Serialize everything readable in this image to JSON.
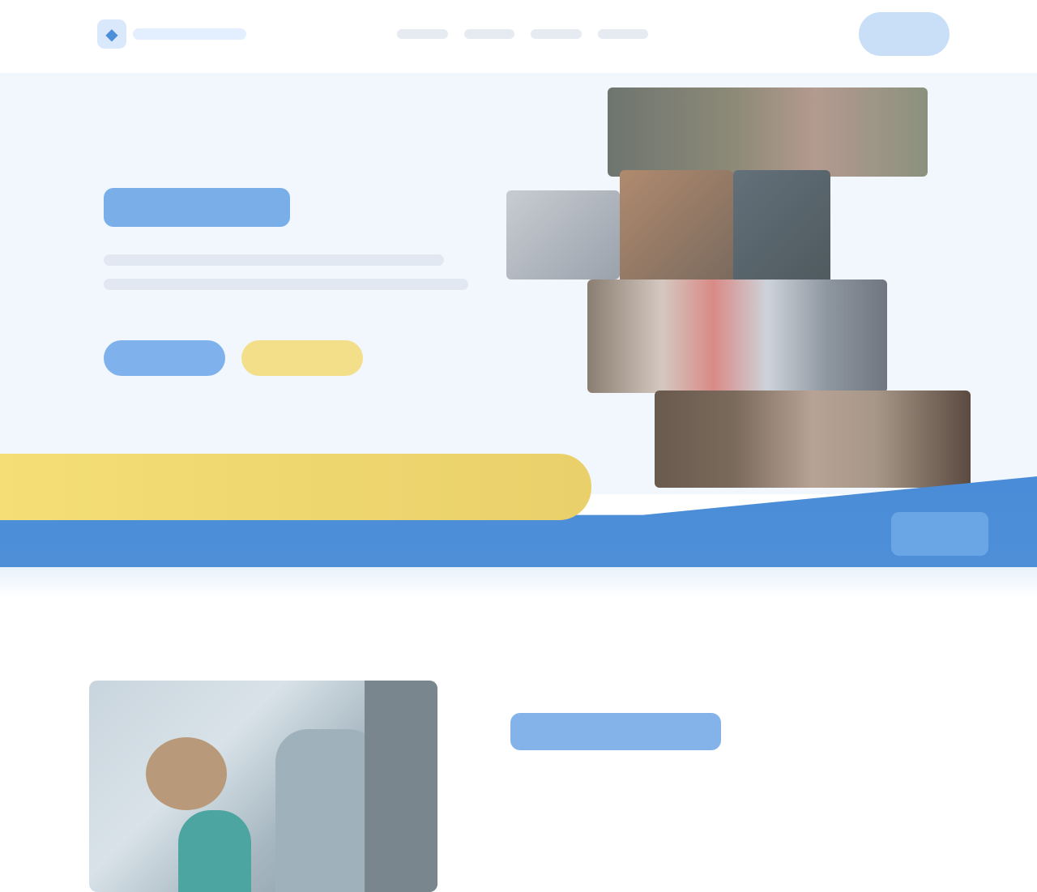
{
  "header": {
    "logo_icon": "logo-icon",
    "logo_text": "",
    "nav": [
      {
        "label": ""
      },
      {
        "label": ""
      },
      {
        "label": ""
      },
      {
        "label": ""
      }
    ],
    "cta_label": ""
  },
  "hero": {
    "title": "",
    "subtitle_lines": [
      "",
      ""
    ],
    "primary_label": "",
    "secondary_label": ""
  },
  "section": {
    "title": ""
  },
  "colors": {
    "accent_blue": "#4a8cd7",
    "accent_yellow": "#f4de75",
    "hero_background": "#f2f7fd"
  }
}
